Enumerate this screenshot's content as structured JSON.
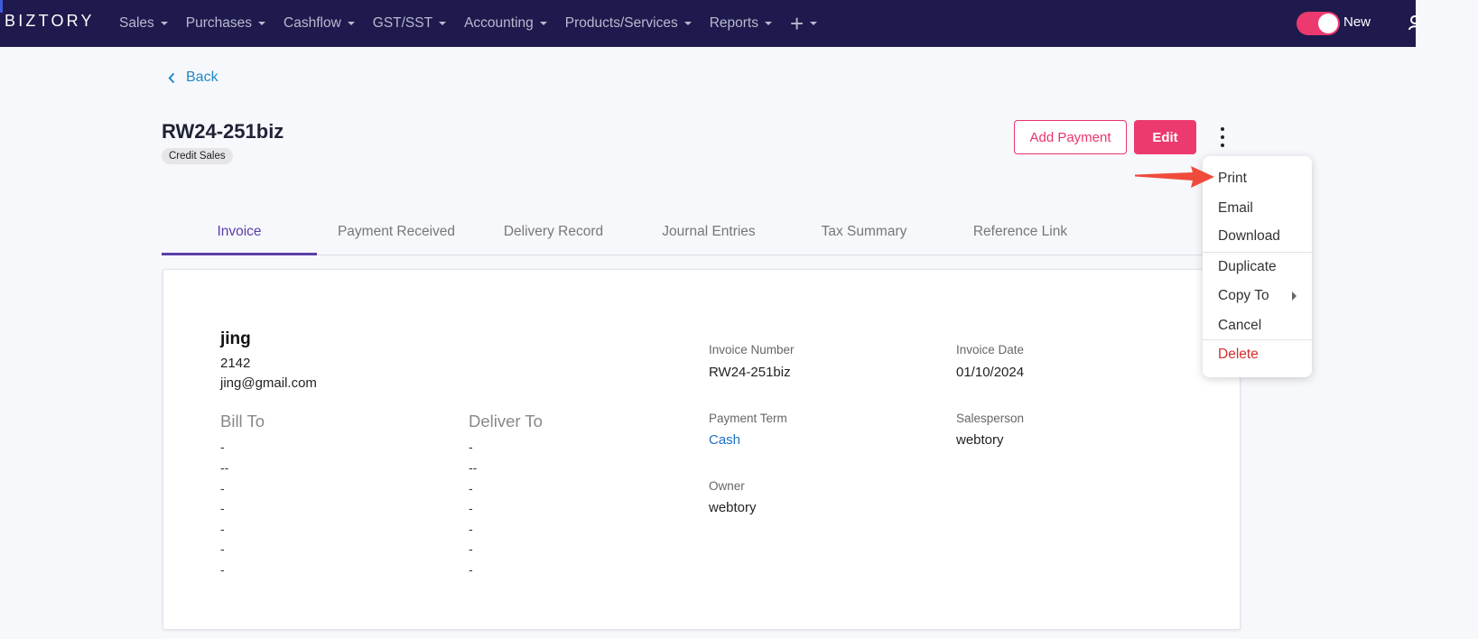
{
  "app": {
    "logo": "BIZTORY"
  },
  "nav": {
    "items": [
      "Sales",
      "Purchases",
      "Cashflow",
      "GST/SST",
      "Accounting",
      "Products/Services",
      "Reports"
    ],
    "toggle_label": "New"
  },
  "header": {
    "back_label": "Back",
    "title": "RW24-251biz",
    "badge": "Credit Sales",
    "add_payment_label": "Add Payment",
    "edit_label": "Edit"
  },
  "tabs": [
    "Invoice",
    "Payment Received",
    "Delivery Record",
    "Journal Entries",
    "Tax Summary",
    "Reference Link"
  ],
  "active_tab": "Invoice",
  "customer": {
    "name": "jing",
    "code": "2142",
    "email": "jing@gmail.com"
  },
  "bill_to": {
    "title": "Bill To",
    "lines": [
      "-",
      "--",
      "-",
      "-",
      "-",
      "-",
      "-"
    ]
  },
  "deliver_to": {
    "title": "Deliver To",
    "lines": [
      "-",
      "--",
      "-",
      "-",
      "-",
      "-",
      "-"
    ]
  },
  "details": {
    "invoice_number_label": "Invoice Number",
    "invoice_number": "RW24-251biz",
    "invoice_date_label": "Invoice Date",
    "invoice_date": "01/10/2024",
    "payment_term_label": "Payment Term",
    "payment_term": "Cash",
    "salesperson_label": "Salesperson",
    "salesperson": "webtory",
    "owner_label": "Owner",
    "owner": "webtory"
  },
  "menu": {
    "items": [
      "Print",
      "Email",
      "Download",
      "Duplicate",
      "Copy To",
      "Cancel",
      "Delete"
    ]
  },
  "colors": {
    "nav_bg": "#1e1a4d",
    "accent": "#ec3a6e",
    "tab_active": "#5b3fa8",
    "link": "#1e88c8",
    "danger": "#d32f2f"
  }
}
